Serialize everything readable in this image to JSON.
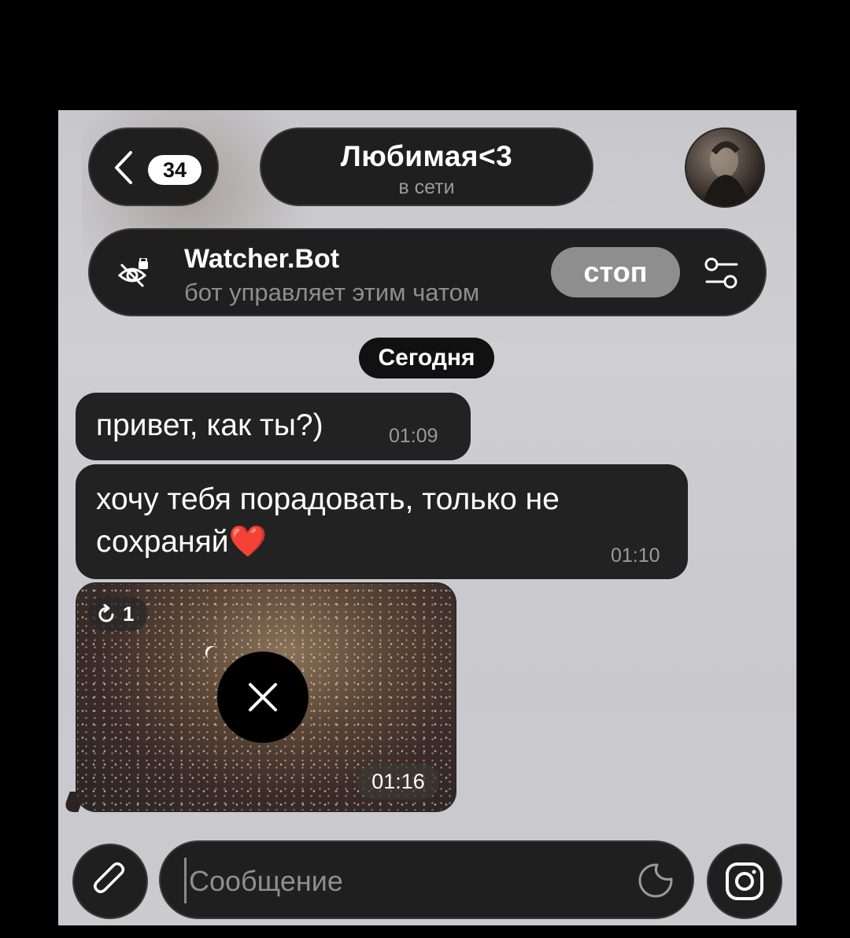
{
  "header": {
    "back_count": "34",
    "chat_title": "Любимая<3",
    "chat_status": "в сети"
  },
  "bot_bar": {
    "name": "Watcher.Bot",
    "description": "бот управляет этим чатом",
    "stop_label": "стоп"
  },
  "date_chip": "Сегодня",
  "messages": [
    {
      "text": "привет, как ты?)",
      "time": "01:09"
    },
    {
      "text": "хочу тебя порадовать, только не сохраняй",
      "emoji": "❤️",
      "time": "01:10"
    }
  ],
  "media_message": {
    "view_count": "1",
    "time": "01:16"
  },
  "composer": {
    "placeholder": "Сообщение"
  },
  "icons": {
    "back": "chevron-left-icon",
    "bot": "eye-off-lock-icon",
    "settings": "sliders-icon",
    "view_once": "refresh-icon",
    "close": "close-icon",
    "attach": "paperclip-icon",
    "sticker": "sticker-icon",
    "camera": "instagram-camera-icon"
  },
  "colors": {
    "bubble": "#222222",
    "chat_background": "#cbcbcf",
    "stop_button": "#8e8e8e",
    "heart": "#e3242b"
  }
}
